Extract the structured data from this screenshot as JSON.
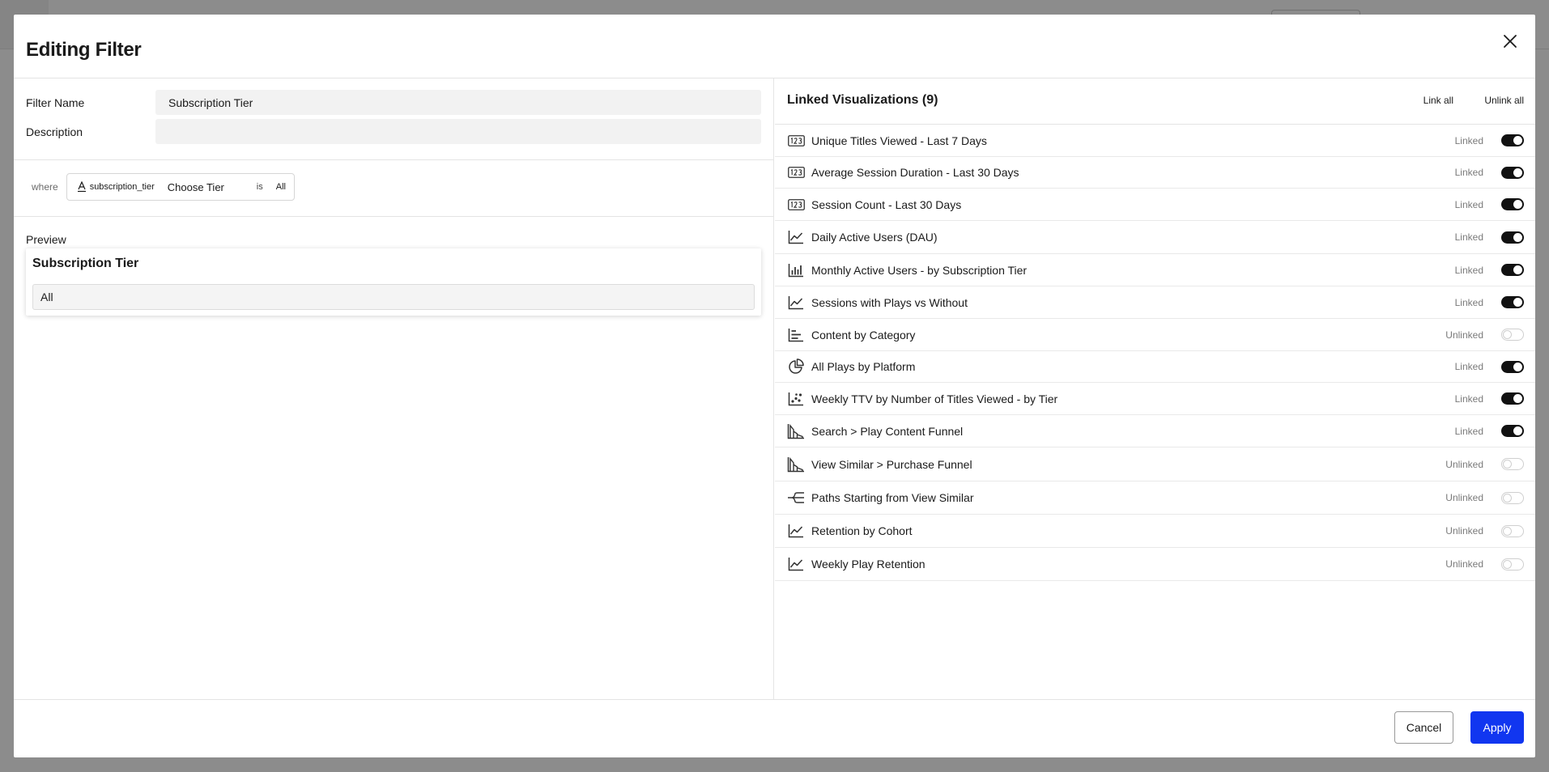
{
  "modal": {
    "title": "Editing Filter"
  },
  "filter": {
    "name_label": "Filter Name",
    "name_value": "Subscription Tier",
    "description_label": "Description",
    "description_value": ""
  },
  "condition": {
    "where_label": "where",
    "field": "subscription_tier",
    "choose": "Choose Tier",
    "operator": "is",
    "value": "All"
  },
  "preview": {
    "label": "Preview",
    "title": "Subscription Tier",
    "selected": "All"
  },
  "linked": {
    "title": "Linked Visualizations (9)",
    "link_all": "Link all",
    "unlink_all": "Unlink all",
    "items": [
      {
        "name": "Unique Titles Viewed - Last 7 Days",
        "status": "Linked",
        "icon": "number-icon",
        "on": true
      },
      {
        "name": "Average Session Duration - Last 30 Days",
        "status": "Linked",
        "icon": "number-icon",
        "on": true
      },
      {
        "name": "Session Count - Last 30 Days",
        "status": "Linked",
        "icon": "number-icon",
        "on": true
      },
      {
        "name": "Daily Active Users (DAU)",
        "status": "Linked",
        "icon": "line-chart-icon",
        "on": true
      },
      {
        "name": "Monthly Active Users - by Subscription Tier",
        "status": "Linked",
        "icon": "bar-chart-icon",
        "on": true
      },
      {
        "name": "Sessions with Plays vs Without",
        "status": "Linked",
        "icon": "line-chart-icon",
        "on": true
      },
      {
        "name": "Content by Category",
        "status": "Unlinked",
        "icon": "horizontal-bar-icon",
        "on": false
      },
      {
        "name": "All Plays by Platform",
        "status": "Linked",
        "icon": "pie-chart-icon",
        "on": true
      },
      {
        "name": "Weekly TTV by Number of Titles Viewed - by Tier",
        "status": "Linked",
        "icon": "scatter-chart-icon",
        "on": true
      },
      {
        "name": "Search > Play Content Funnel",
        "status": "Linked",
        "icon": "funnel-icon",
        "on": true
      },
      {
        "name": "View Similar > Purchase Funnel",
        "status": "Unlinked",
        "icon": "funnel-icon",
        "on": false
      },
      {
        "name": "Paths Starting from View Similar",
        "status": "Unlinked",
        "icon": "paths-icon",
        "on": false
      },
      {
        "name": "Retention by Cohort",
        "status": "Unlinked",
        "icon": "line-chart-icon",
        "on": false
      },
      {
        "name": "Weekly Play Retention",
        "status": "Unlinked",
        "icon": "line-chart-icon",
        "on": false
      }
    ]
  },
  "footer": {
    "cancel": "Cancel",
    "apply": "Apply"
  },
  "colors": {
    "apply": "#1136f0",
    "toggle_on": "#111111"
  }
}
